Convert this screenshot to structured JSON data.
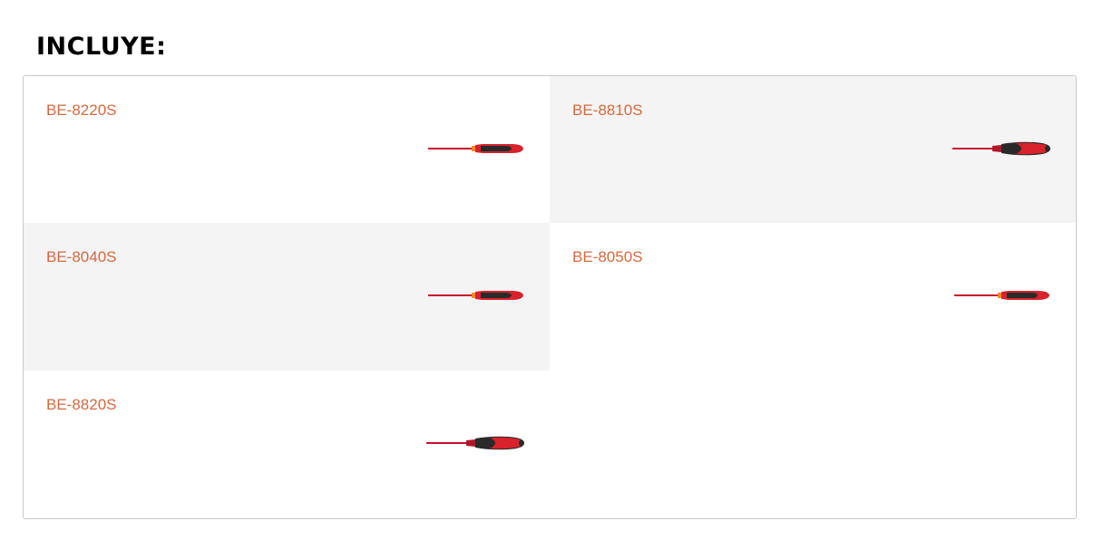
{
  "heading": "INCLUYE:",
  "items": [
    {
      "code": "BE-8220S",
      "tool_icon": "slim-screwdriver-icon"
    },
    {
      "code": "BE-8810S",
      "tool_icon": "round-handle-screwdriver-icon"
    },
    {
      "code": "BE-8040S",
      "tool_icon": "slim-screwdriver-icon"
    },
    {
      "code": "BE-8050S",
      "tool_icon": "slim-screwdriver-icon"
    },
    {
      "code": "BE-8820S",
      "tool_icon": "round-handle-screwdriver-icon"
    }
  ],
  "colors": {
    "link": "#d3693f",
    "shaded_cell": "#f4f4f4",
    "handle_red": "#d8222c",
    "handle_black": "#2a2a2a",
    "shaft_red": "#c8102e",
    "collar_orange": "#f08a1c"
  }
}
